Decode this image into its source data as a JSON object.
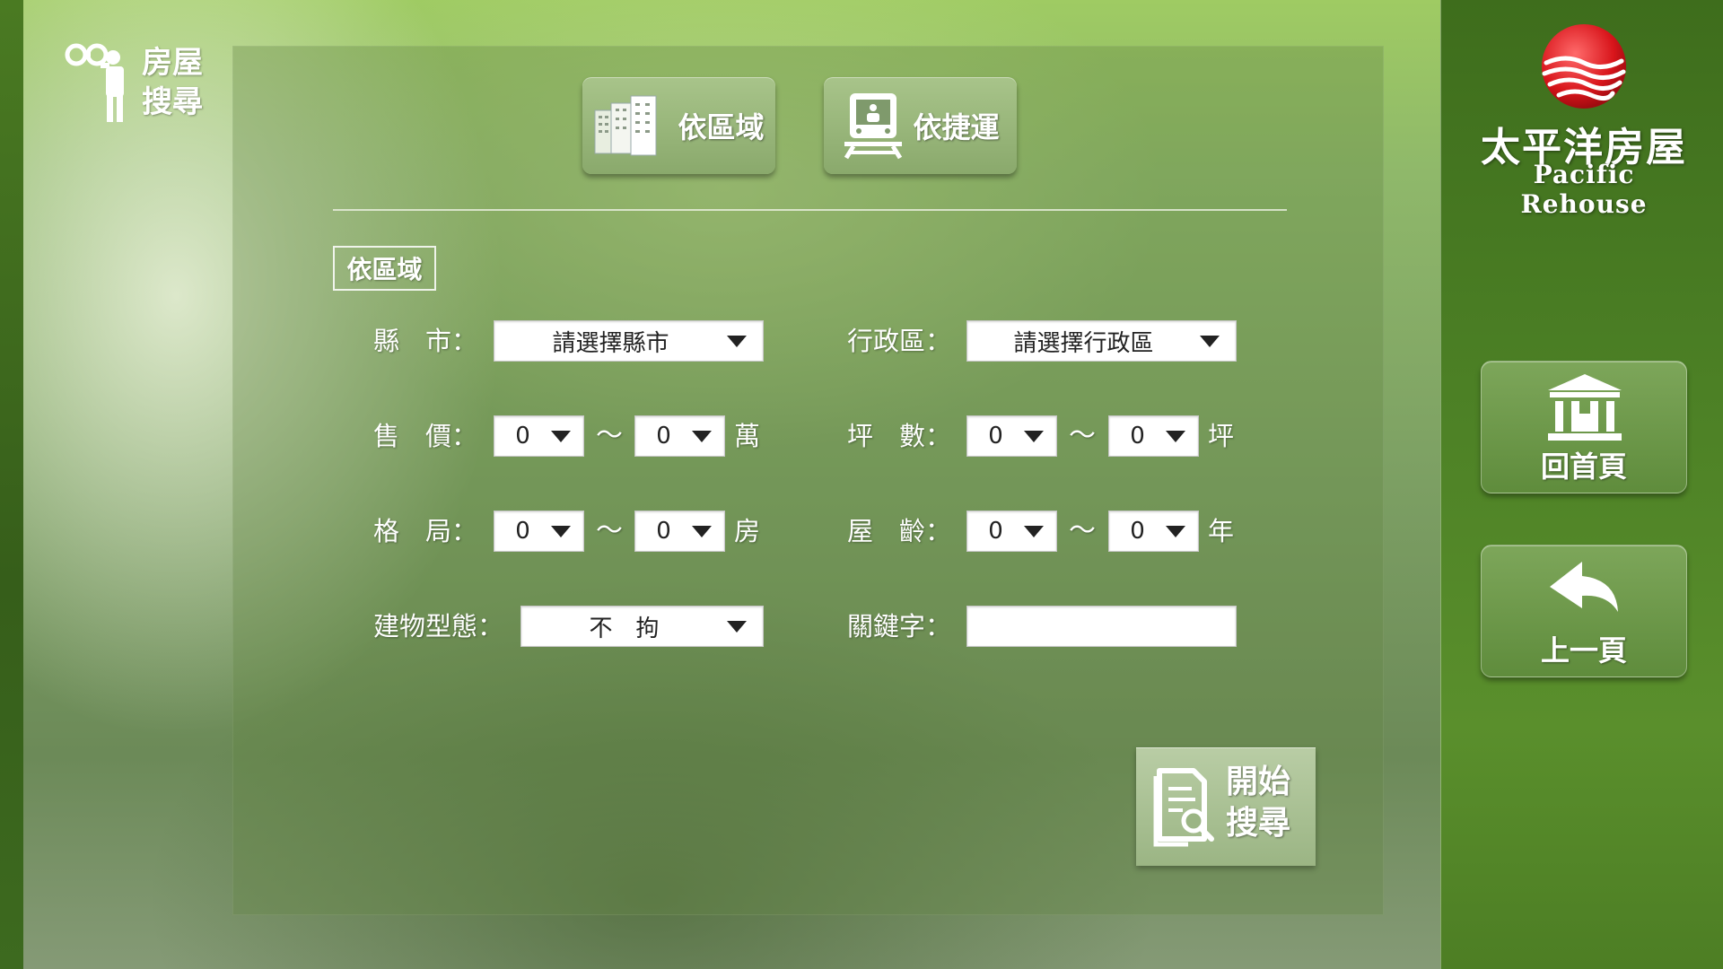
{
  "header": {
    "page_title_line1": "房屋",
    "page_title_line2": "搜尋"
  },
  "modes": {
    "by_area": "依區域",
    "by_mrt": "依捷運"
  },
  "section": {
    "title": "依區域"
  },
  "form": {
    "city_label": "縣　市：",
    "city_value": "請選擇縣市",
    "district_label": "行政區：",
    "district_value": "請選擇行政區",
    "price_label": "售　價：",
    "price_min": "0",
    "price_max": "0",
    "price_unit": "萬",
    "area_label": "坪　數：",
    "area_min": "0",
    "area_max": "0",
    "area_unit": "坪",
    "layout_label": "格　局：",
    "layout_min": "0",
    "layout_max": "0",
    "layout_unit": "房",
    "age_label": "屋　齡：",
    "age_min": "0",
    "age_max": "0",
    "age_unit": "年",
    "type_label": "建物型態：",
    "type_value": "不　拘",
    "keyword_label": "關鍵字：",
    "keyword_value": "",
    "range_sep": "～"
  },
  "search_button": {
    "line1": "開始",
    "line2": "搜尋"
  },
  "sidebar": {
    "brand_zh": "太平洋房屋",
    "brand_en": "Pacific Rehouse",
    "home_label": "回首頁",
    "back_label": "上一頁"
  },
  "icons": {
    "page": "binoculars-person-icon",
    "by_area": "buildings-icon",
    "by_mrt": "train-icon",
    "search": "document-search-icon",
    "home": "bank-building-icon",
    "back": "back-arrow-icon",
    "logo": "globe-logo-icon"
  }
}
